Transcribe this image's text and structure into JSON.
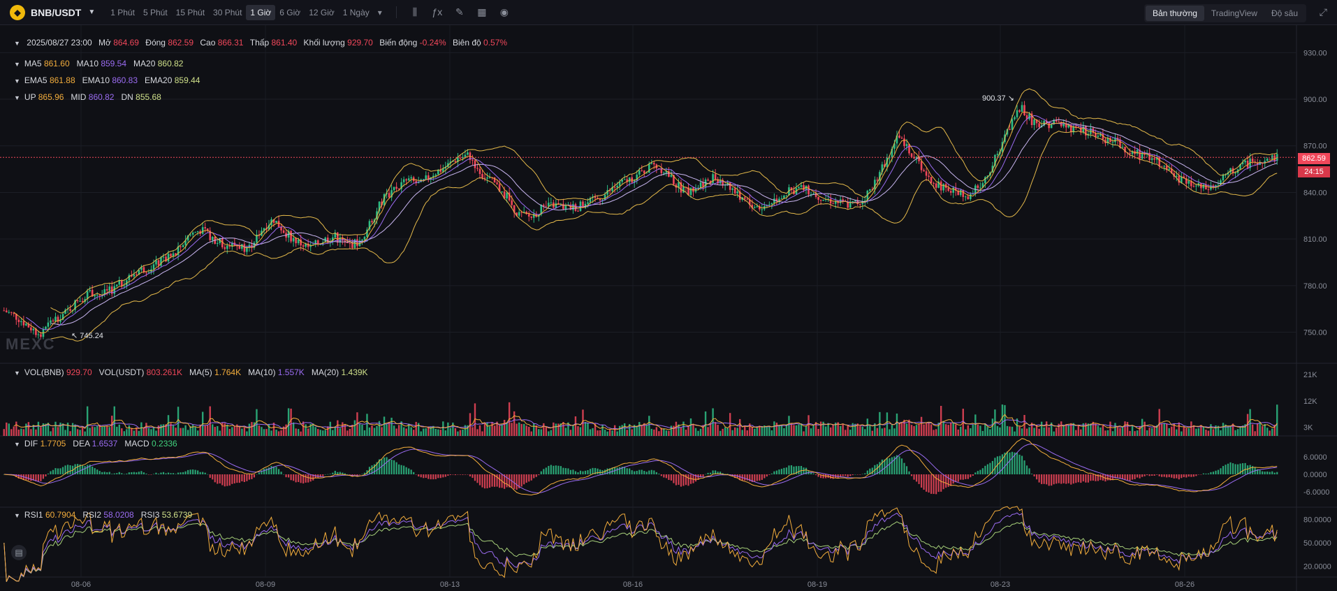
{
  "header": {
    "pair": "BNB/USDT",
    "logo_icon": "bnb-logo-icon",
    "intervals": [
      "1 Phút",
      "5 Phút",
      "15 Phút",
      "30 Phút",
      "1 Giờ",
      "6 Giờ",
      "12 Giờ",
      "1 Ngày"
    ],
    "active_interval": "1 Giờ",
    "views": [
      "Bản thường",
      "TradingView",
      "Độ sâu"
    ],
    "active_view": "Bản thường"
  },
  "legend": {
    "date": "2025/08/27 23:00",
    "open_label": "Mở",
    "open": "864.69",
    "close_label": "Đóng",
    "close": "862.59",
    "high_label": "Cao",
    "high": "866.31",
    "low_label": "Thấp",
    "low": "861.40",
    "volume_label": "Khối lượng",
    "volume": "929.70",
    "change_label": "Biến động",
    "change": "-0.24%",
    "amp_label": "Biên độ",
    "amp": "0.57%",
    "ma": [
      {
        "k": "MA5",
        "v": "861.60"
      },
      {
        "k": "MA10",
        "v": "859.54"
      },
      {
        "k": "MA20",
        "v": "860.82"
      }
    ],
    "ema": [
      {
        "k": "EMA5",
        "v": "861.88"
      },
      {
        "k": "EMA10",
        "v": "860.83"
      },
      {
        "k": "EMA20",
        "v": "859.44"
      }
    ],
    "boll": [
      {
        "k": "UP",
        "v": "865.96"
      },
      {
        "k": "MID",
        "v": "860.82"
      },
      {
        "k": "DN",
        "v": "855.68"
      }
    ],
    "vol": [
      {
        "k": "VOL(BNB)",
        "v": "929.70"
      },
      {
        "k": "VOL(USDT)",
        "v": "803.261K"
      },
      {
        "k": "MA(5)",
        "v": "1.764K"
      },
      {
        "k": "MA(10)",
        "v": "1.557K"
      },
      {
        "k": "MA(20)",
        "v": "1.439K"
      }
    ],
    "macd": [
      {
        "k": "DIF",
        "v": "1.7705"
      },
      {
        "k": "DEA",
        "v": "1.6537"
      },
      {
        "k": "MACD",
        "v": "0.2336"
      }
    ],
    "rsi": [
      {
        "k": "RSI1",
        "v": "60.7904"
      },
      {
        "k": "RSI2",
        "v": "58.0208"
      },
      {
        "k": "RSI3",
        "v": "53.6739"
      }
    ]
  },
  "watermark": "MEXC",
  "current_price": "862.59",
  "countdown": "24:15",
  "high_marker": "900.37",
  "low_marker": "745.24",
  "colors": {
    "up": "#2ebd85",
    "down": "#f0475a",
    "ma5": "#f3ad3c",
    "ma10": "#9b6cf2",
    "ma20": "#d8c86e",
    "boll": "#e4b94a"
  },
  "chart_data": {
    "type": "candlestick",
    "price_axis": {
      "ticks": [
        "930.00",
        "900.00",
        "870.00",
        "840.00",
        "810.00",
        "780.00",
        "750.00"
      ],
      "range": [
        730,
        945
      ]
    },
    "volume_axis": {
      "ticks": [
        "21K",
        "12K",
        "3K"
      ]
    },
    "macd_axis": {
      "ticks": [
        "6.0000",
        "0.0000",
        "-6.0000"
      ]
    },
    "rsi_axis": {
      "ticks": [
        "80.0000",
        "50.0000",
        "20.0000"
      ]
    },
    "x_ticks": [
      "08-06",
      "08-09",
      "08-13",
      "08-16",
      "08-19",
      "08-23",
      "08-26"
    ],
    "close_path": [
      [
        0,
        764
      ],
      [
        10,
        760
      ],
      [
        20,
        754
      ],
      [
        30,
        748
      ],
      [
        40,
        758
      ],
      [
        50,
        762
      ],
      [
        60,
        770
      ],
      [
        70,
        776
      ],
      [
        80,
        774
      ],
      [
        90,
        778
      ],
      [
        100,
        784
      ],
      [
        110,
        790
      ],
      [
        120,
        792
      ],
      [
        130,
        796
      ],
      [
        140,
        800
      ],
      [
        150,
        812
      ],
      [
        160,
        816
      ],
      [
        170,
        811
      ],
      [
        180,
        806
      ],
      [
        190,
        806
      ],
      [
        200,
        804
      ],
      [
        210,
        816
      ],
      [
        220,
        823
      ],
      [
        230,
        814
      ],
      [
        240,
        808
      ],
      [
        250,
        804
      ],
      [
        260,
        809
      ],
      [
        270,
        812
      ],
      [
        280,
        806
      ],
      [
        290,
        808
      ],
      [
        300,
        822
      ],
      [
        310,
        836
      ],
      [
        320,
        843
      ],
      [
        330,
        848
      ],
      [
        340,
        845
      ],
      [
        350,
        852
      ],
      [
        360,
        856
      ],
      [
        370,
        862
      ],
      [
        380,
        864
      ],
      [
        390,
        852
      ],
      [
        400,
        846
      ],
      [
        410,
        838
      ],
      [
        420,
        826
      ],
      [
        430,
        824
      ],
      [
        440,
        830
      ],
      [
        450,
        832
      ],
      [
        460,
        830
      ],
      [
        470,
        831
      ],
      [
        480,
        834
      ],
      [
        490,
        838
      ],
      [
        500,
        844
      ],
      [
        510,
        848
      ],
      [
        520,
        852
      ],
      [
        530,
        858
      ],
      [
        540,
        854
      ],
      [
        550,
        844
      ],
      [
        560,
        840
      ],
      [
        570,
        846
      ],
      [
        580,
        850
      ],
      [
        590,
        846
      ],
      [
        600,
        838
      ],
      [
        610,
        832
      ],
      [
        620,
        830
      ],
      [
        630,
        836
      ],
      [
        640,
        840
      ],
      [
        650,
        843
      ],
      [
        660,
        840
      ],
      [
        670,
        836
      ],
      [
        680,
        834
      ],
      [
        690,
        832
      ],
      [
        700,
        834
      ],
      [
        710,
        844
      ],
      [
        720,
        860
      ],
      [
        730,
        876
      ],
      [
        740,
        866
      ],
      [
        750,
        856
      ],
      [
        760,
        846
      ],
      [
        770,
        842
      ],
      [
        780,
        840
      ],
      [
        790,
        838
      ],
      [
        800,
        848
      ],
      [
        810,
        862
      ],
      [
        820,
        880
      ],
      [
        830,
        895
      ],
      [
        840,
        886
      ],
      [
        850,
        884
      ],
      [
        860,
        885
      ],
      [
        870,
        882
      ],
      [
        880,
        880
      ],
      [
        890,
        878
      ],
      [
        900,
        874
      ],
      [
        910,
        872
      ],
      [
        920,
        866
      ],
      [
        930,
        864
      ],
      [
        940,
        862
      ],
      [
        950,
        856
      ],
      [
        960,
        848
      ],
      [
        970,
        845
      ],
      [
        980,
        842
      ],
      [
        990,
        844
      ],
      [
        1000,
        852
      ],
      [
        1010,
        856
      ],
      [
        1020,
        860
      ],
      [
        1030,
        860
      ],
      [
        1040,
        862
      ]
    ],
    "candle_count": 520
  }
}
